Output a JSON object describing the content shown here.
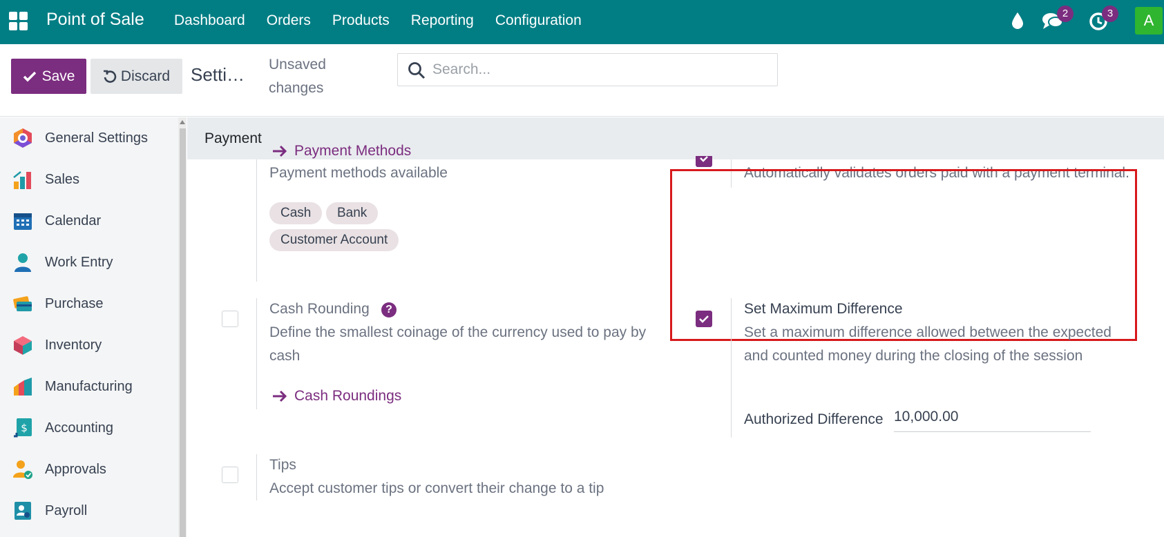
{
  "app": {
    "title": "Point of Sale"
  },
  "menu": [
    "Dashboard",
    "Orders",
    "Products",
    "Reporting",
    "Configuration"
  ],
  "systray": {
    "messages_count": "2",
    "activities_count": "3",
    "avatar_letter": "A"
  },
  "control_panel": {
    "save_label": "Save",
    "discard_label": "Discard",
    "breadcrumb": "Settin…",
    "unsaved": "Unsaved changes",
    "search_placeholder": "Search..."
  },
  "sidebar": {
    "items": [
      {
        "label": "General Settings",
        "icon": "general-settings-icon"
      },
      {
        "label": "Sales",
        "icon": "sales-icon"
      },
      {
        "label": "Calendar",
        "icon": "calendar-icon"
      },
      {
        "label": "Work Entry",
        "icon": "work-entry-icon"
      },
      {
        "label": "Purchase",
        "icon": "purchase-icon"
      },
      {
        "label": "Inventory",
        "icon": "inventory-icon"
      },
      {
        "label": "Manufacturing",
        "icon": "manufacturing-icon"
      },
      {
        "label": "Accounting",
        "icon": "accounting-icon"
      },
      {
        "label": "Approvals",
        "icon": "approvals-icon"
      },
      {
        "label": "Payroll",
        "icon": "payroll-icon"
      }
    ]
  },
  "section": {
    "title": "Payment"
  },
  "payment_methods": {
    "desc": "Payment methods available",
    "tags": [
      "Cash",
      "Bank",
      "Customer Account"
    ],
    "link": "Payment Methods"
  },
  "auto_validate": {
    "desc": "Automatically validates orders paid with a payment terminal.",
    "checked": true
  },
  "cash_rounding": {
    "title": "Cash Rounding",
    "desc": "Define the smallest coinage of the currency used to pay by cash",
    "link": "Cash Roundings",
    "checked": false
  },
  "max_difference": {
    "title": "Set Maximum Difference",
    "desc": "Set a maximum difference allowed between the expected and counted money during the closing of the session",
    "field_label": "Authorized Difference",
    "field_value": "10,000.00",
    "checked": true
  },
  "tips": {
    "title": "Tips",
    "desc": "Accept customer tips or convert their change to a tip",
    "checked": false
  },
  "colors": {
    "topbar": "#017e84",
    "primary": "#7b2d7f",
    "highlight": "#d7191c"
  }
}
